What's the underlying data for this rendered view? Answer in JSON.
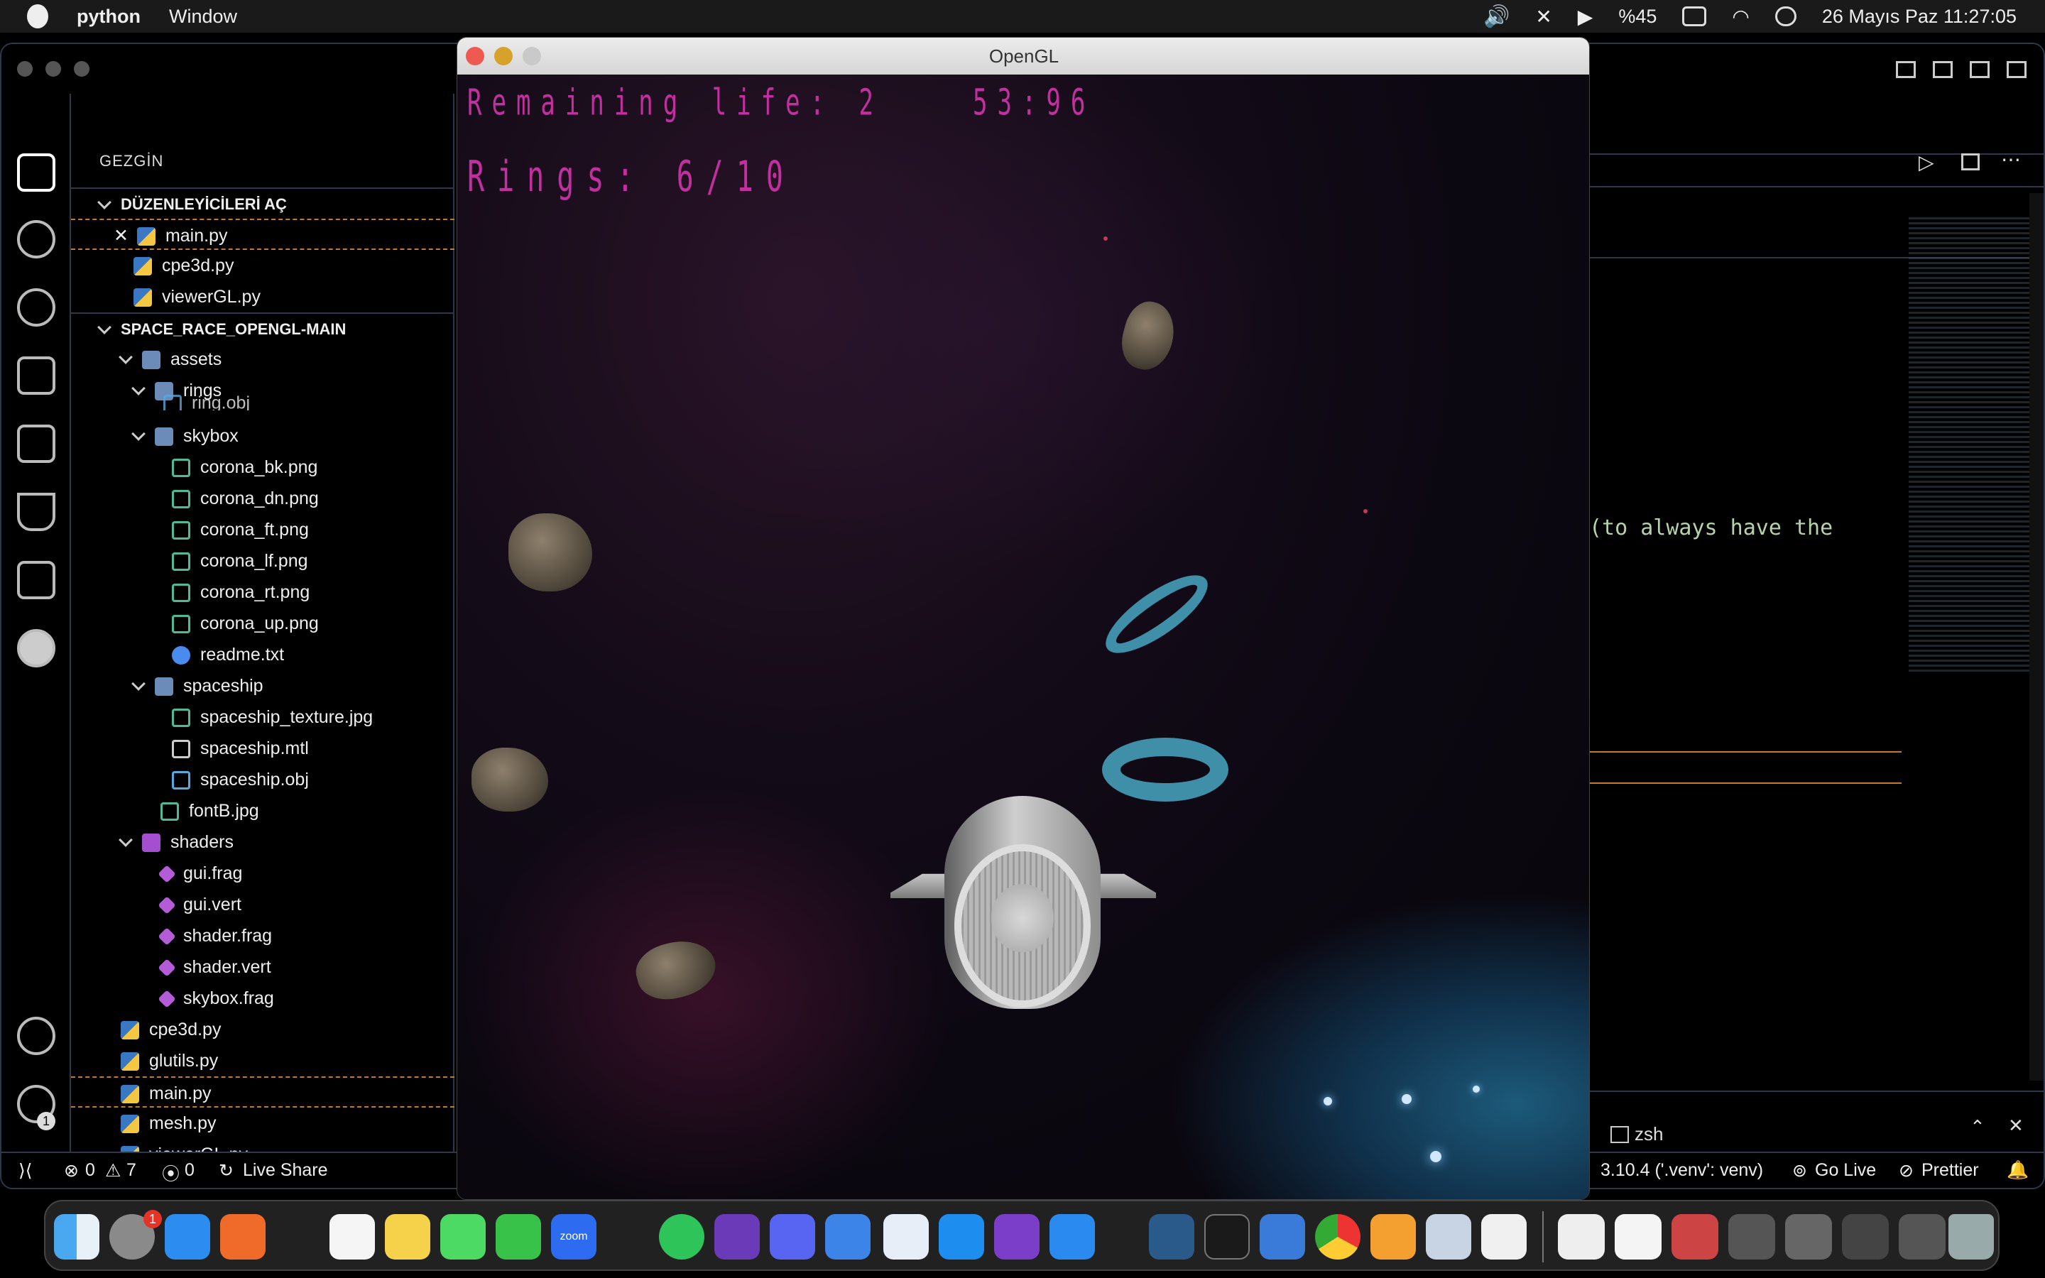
{
  "menubar": {
    "app_name": "python",
    "menu_window": "Window",
    "battery_label": "%45",
    "datetime": "26 Mayıs Paz  11:27:05"
  },
  "sidebar": {
    "title": "GEZGİN",
    "open_editors": {
      "label": "DÜZENLEYİCİLERİ AÇ",
      "files": [
        "main.py",
        "cpe3d.py",
        "viewerGL.py"
      ]
    },
    "project": {
      "label": "SPACE_RACE_OPENGL-MAIN",
      "items": [
        {
          "label": "assets",
          "type": "folder"
        },
        {
          "label": "rings",
          "type": "folder"
        },
        {
          "label": "ring.obj",
          "type": "obj"
        },
        {
          "label": "skybox",
          "type": "folder"
        },
        {
          "label": "corona_bk.png",
          "type": "image"
        },
        {
          "label": "corona_dn.png",
          "type": "image"
        },
        {
          "label": "corona_ft.png",
          "type": "image"
        },
        {
          "label": "corona_lf.png",
          "type": "image"
        },
        {
          "label": "corona_rt.png",
          "type": "image"
        },
        {
          "label": "corona_up.png",
          "type": "image"
        },
        {
          "label": "readme.txt",
          "type": "info"
        },
        {
          "label": "spaceship",
          "type": "folder"
        },
        {
          "label": "spaceship_texture.jpg",
          "type": "image"
        },
        {
          "label": "spaceship.mtl",
          "type": "mtl"
        },
        {
          "label": "spaceship.obj",
          "type": "obj"
        },
        {
          "label": "fontB.jpg",
          "type": "image"
        },
        {
          "label": "shaders",
          "type": "folder"
        },
        {
          "label": "gui.frag",
          "type": "glsl"
        },
        {
          "label": "gui.vert",
          "type": "glsl"
        },
        {
          "label": "shader.frag",
          "type": "glsl"
        },
        {
          "label": "shader.vert",
          "type": "glsl"
        },
        {
          "label": "skybox.frag",
          "type": "glsl"
        },
        {
          "label": "cpe3d.py",
          "type": "python"
        },
        {
          "label": "glutils.py",
          "type": "python"
        },
        {
          "label": "main.py",
          "type": "python"
        },
        {
          "label": "mesh.py",
          "type": "python"
        },
        {
          "label": "viewerGL.py",
          "type": "python"
        }
      ]
    }
  },
  "editor": {
    "code_fragment": "(to always have the"
  },
  "terminal": {
    "shell_label": "zsh"
  },
  "statusbar": {
    "errors": "0",
    "warnings": "7",
    "ports": "0",
    "live_share": "Live Share",
    "interpreter": "3.10.4 ('.venv': venv)",
    "go_live": "Go Live",
    "prettier": "Prettier"
  },
  "opengl_window": {
    "title": "OpenGL",
    "hud": {
      "remaining_life": "Remaining life: 2",
      "timer": "53:96",
      "rings": "Rings: 6/10"
    }
  },
  "dock": {
    "badge_count": "1",
    "zoom_label": "zoom"
  },
  "colors": {
    "hud_text": "#c22f9e",
    "ring": "#3f8fa8",
    "selection_border": "#c8782a"
  }
}
